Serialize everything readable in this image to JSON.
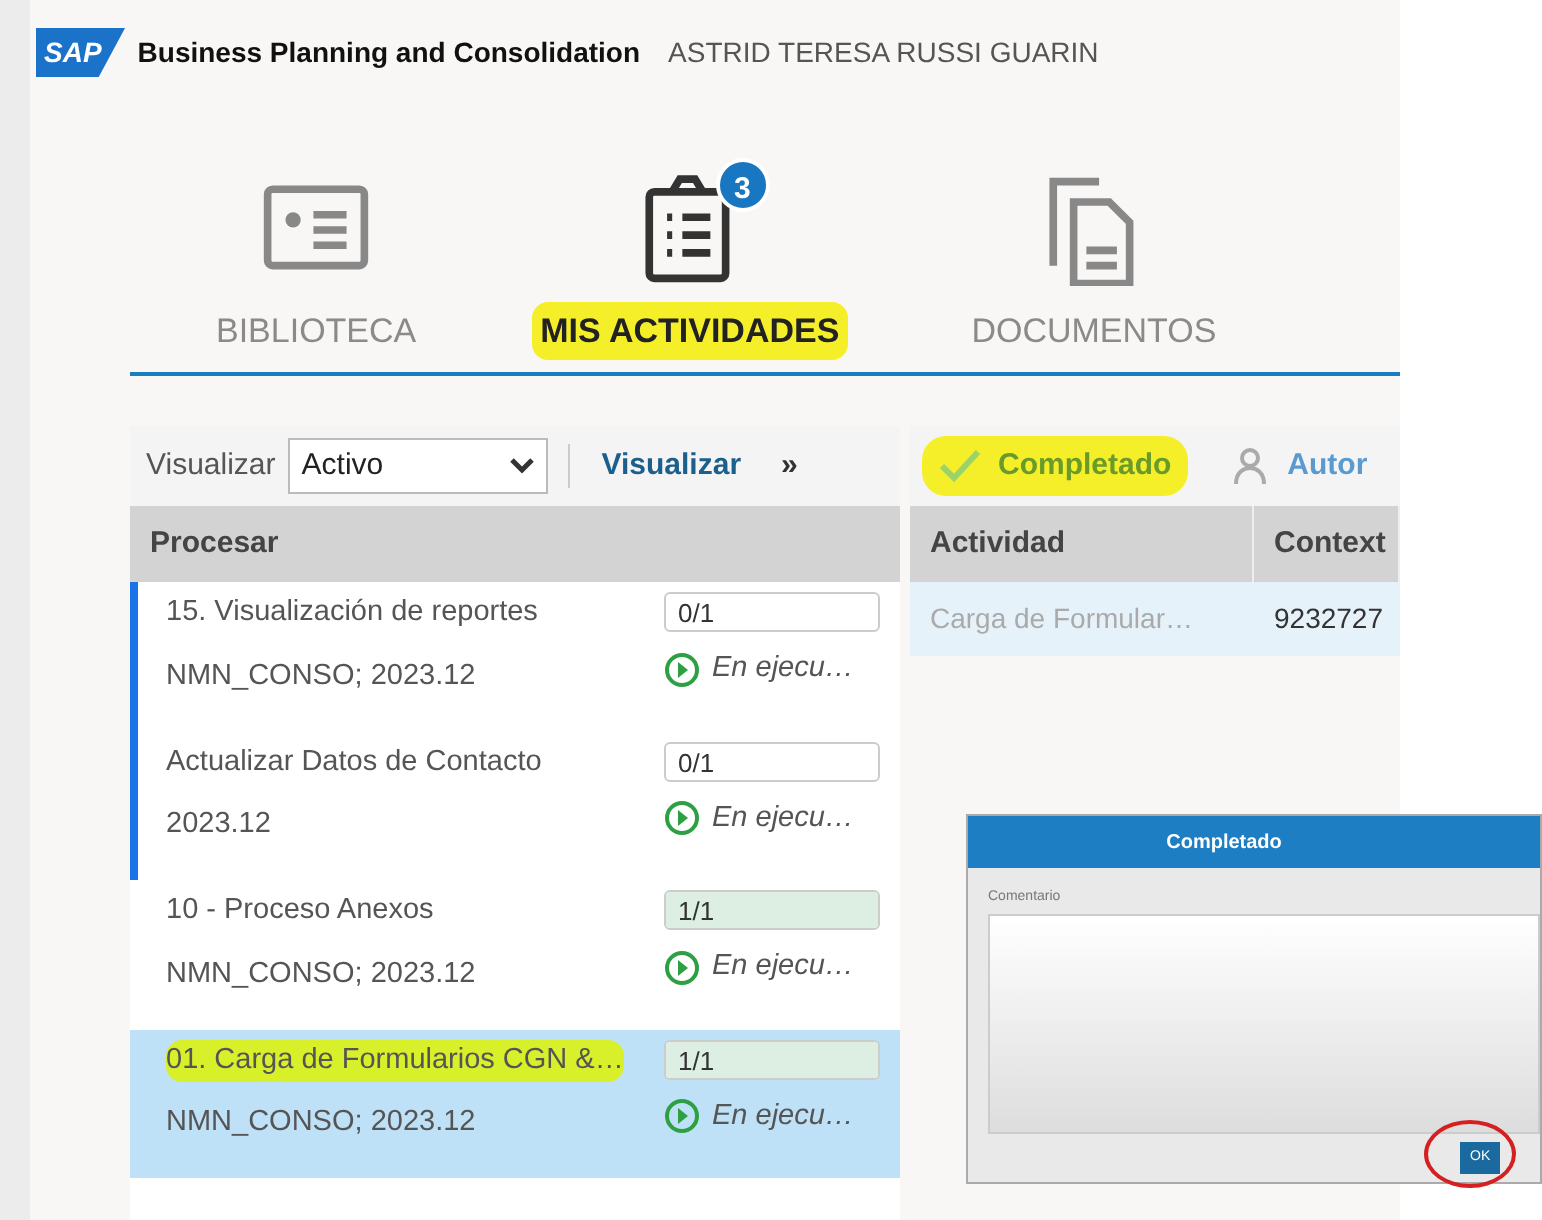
{
  "header": {
    "logo": "SAP",
    "app_title": "Business Planning and Consolidation",
    "user": "ASTRID TERESA RUSSI GUARIN"
  },
  "tabs": [
    {
      "label": "BIBLIOTECA",
      "kind": "library",
      "selected": false,
      "highlighted": false
    },
    {
      "label": "MIS ACTIVIDADES",
      "kind": "activities",
      "selected": true,
      "highlighted": true,
      "badge": "3"
    },
    {
      "label": "DOCUMENTOS",
      "kind": "documents",
      "selected": false,
      "highlighted": false
    }
  ],
  "left_panel": {
    "filter_label": "Visualizar",
    "filter_value": "Activo",
    "view_menu": "Visualizar",
    "overflow": "»",
    "column": "Procesar",
    "rows": [
      {
        "title": "15. Visualización de reportes",
        "context": "NMN_CONSO; 2023.12",
        "progress": "0/1",
        "level": 0,
        "status": "En ejecu…",
        "flagged": true,
        "selected": false,
        "highlighted": false
      },
      {
        "title": "Actualizar Datos de Contacto",
        "context": "2023.12",
        "progress": "0/1",
        "level": 0,
        "status": "En ejecu…",
        "flagged": true,
        "selected": false,
        "highlighted": false
      },
      {
        "title": "10 - Proceso Anexos",
        "context": "NMN_CONSO; 2023.12",
        "progress": "1/1",
        "level": 1,
        "status": "En ejecu…",
        "flagged": false,
        "selected": false,
        "highlighted": false
      },
      {
        "title": "01. Carga de Formularios CGN &…",
        "context": "NMN_CONSO; 2023.12",
        "progress": "1/1",
        "level": 1,
        "status": "En ejecu…",
        "flagged": false,
        "selected": true,
        "highlighted": true
      }
    ]
  },
  "right_panel": {
    "toolbar": [
      {
        "label": "Completado",
        "kind": "complete",
        "highlighted": true
      },
      {
        "label": "Autor",
        "kind": "assign",
        "highlighted": false
      }
    ],
    "columns": [
      "Actividad",
      "Context"
    ],
    "rows": [
      [
        "Carga de Formular…",
        "9232727"
      ]
    ]
  },
  "dialog": {
    "title": "Completado",
    "field_label": "Comentario",
    "ok_button": "OK",
    "ok_circled": true
  }
}
